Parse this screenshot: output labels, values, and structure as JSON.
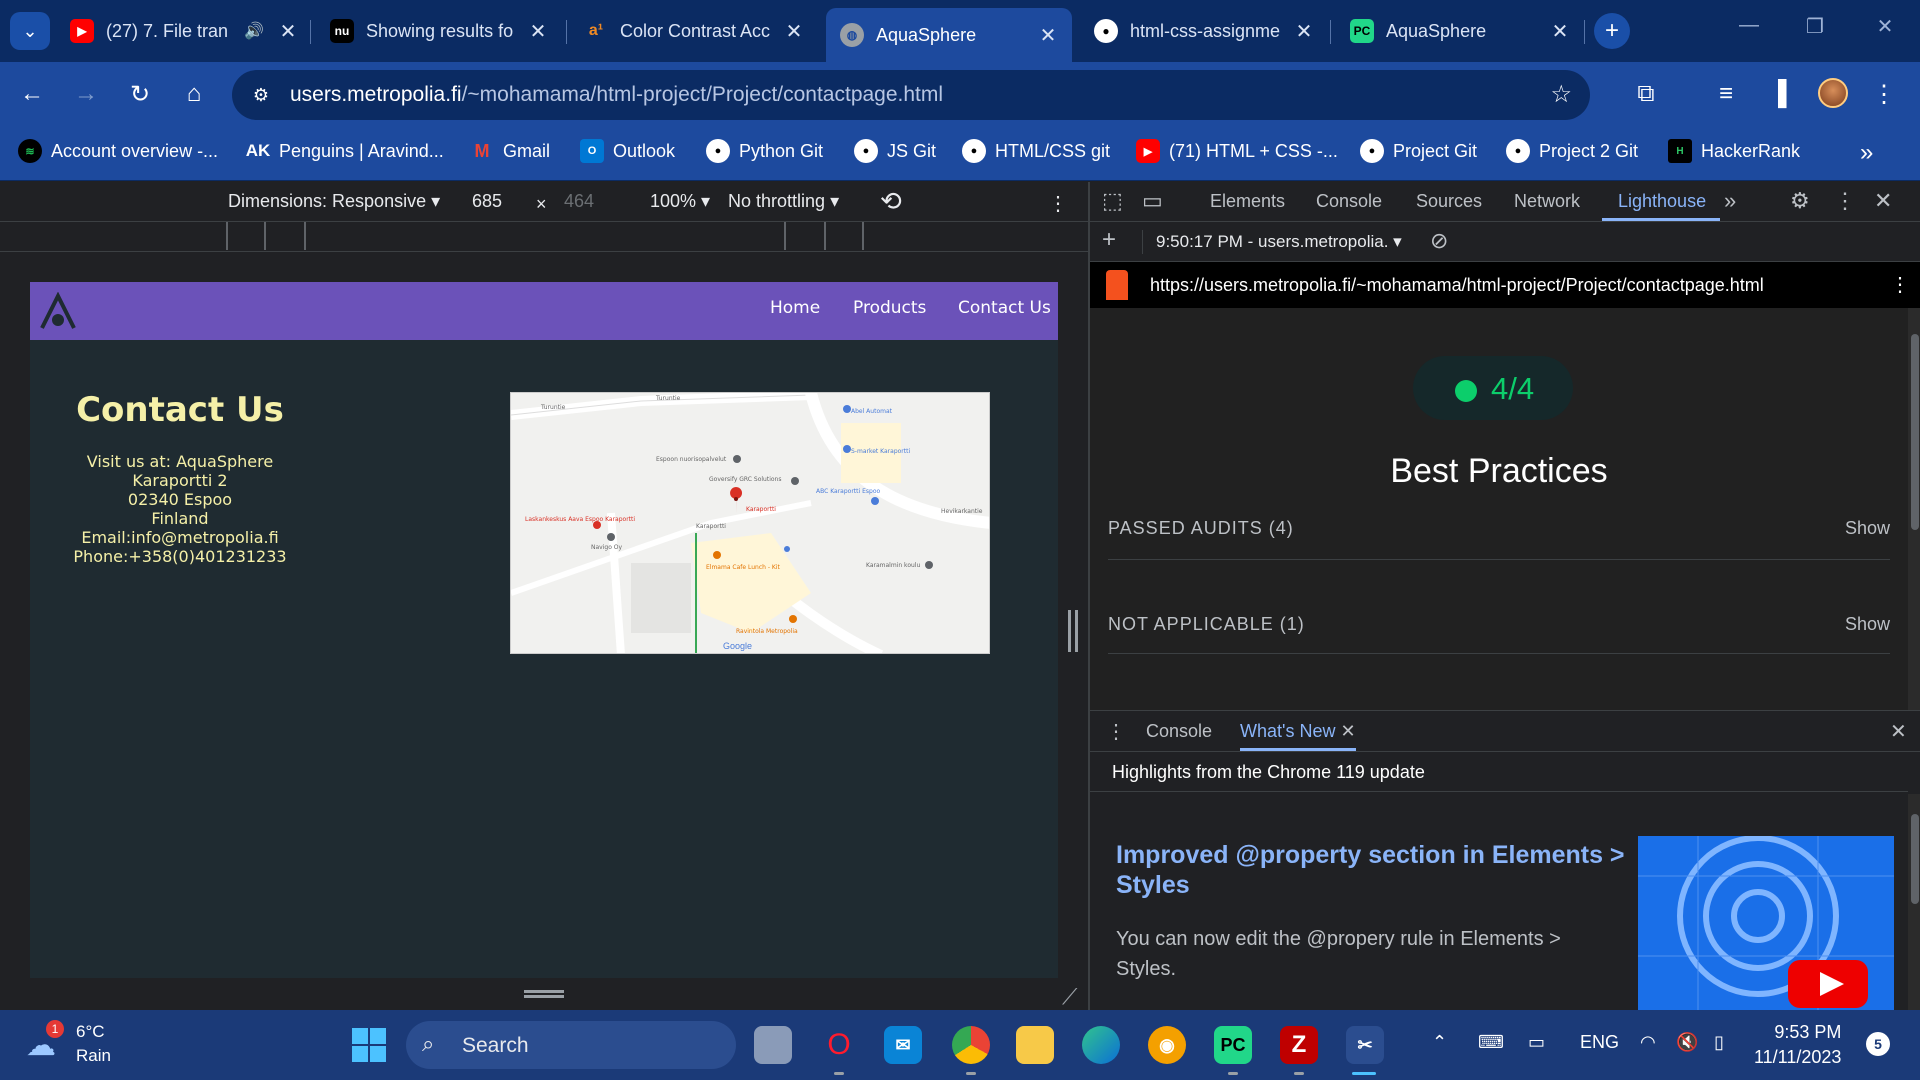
{
  "browser": {
    "tabs": [
      {
        "title": "(27) 7. File tran",
        "icon": "youtube-icon",
        "color": "#ff0000"
      },
      {
        "title": "Showing results fo",
        "icon": "nu-icon",
        "color": "#000000"
      },
      {
        "title": "Color Contrast Acc",
        "icon": "a11y-icon",
        "color": "#f08a24"
      },
      {
        "title": "AquaSphere",
        "icon": "globe-icon",
        "color": "#ffffff",
        "active": true
      },
      {
        "title": "html-css-assignme",
        "icon": "github-icon",
        "color": "#ffffff"
      },
      {
        "title": "AquaSphere",
        "icon": "pycharm-icon",
        "color": "#21d789"
      }
    ],
    "new_tab": "+",
    "window_controls": [
      "—",
      "❐",
      "✕"
    ],
    "url_host": "users.metropolia.fi",
    "url_path": "/~mohamama/html-project/Project/contactpage.html",
    "bookmarks": [
      {
        "label": "Account overview -...",
        "icon": "spotify-icon",
        "color": "#1db954"
      },
      {
        "label": "Penguins | Aravind...",
        "icon": "ak-icon",
        "color": "#ffffff"
      },
      {
        "label": "Gmail",
        "icon": "gmail-icon",
        "color": "#ea4335"
      },
      {
        "label": "Outlook",
        "icon": "outlook-icon",
        "color": "#0078d4"
      },
      {
        "label": "Python Git",
        "icon": "github-icon",
        "color": "#ffffff"
      },
      {
        "label": "JS Git",
        "icon": "github-icon",
        "color": "#ffffff"
      },
      {
        "label": "HTML/CSS git",
        "icon": "github-icon",
        "color": "#ffffff"
      },
      {
        "label": "(71) HTML + CSS -...",
        "icon": "youtube-icon",
        "color": "#ff0000"
      },
      {
        "label": "Project Git",
        "icon": "github-icon",
        "color": "#ffffff"
      },
      {
        "label": "Project 2 Git",
        "icon": "github-icon",
        "color": "#ffffff"
      },
      {
        "label": "HackerRank",
        "icon": "hackerrank-icon",
        "color": "#2ec866"
      }
    ]
  },
  "device_toolbar": {
    "dimensions": "Dimensions: Responsive",
    "width": "685",
    "times": "×",
    "height": "464",
    "zoom": "100%",
    "throttling": "No throttling"
  },
  "website": {
    "nav": [
      "Home",
      "Products",
      "Contact Us"
    ],
    "heading": "Contact Us",
    "lines": [
      "Visit us at: AquaSphere",
      "Karaportti 2",
      "02340 Espoo",
      "Finland",
      "Email:info@metropolia.fi",
      "Phone:+358(0)401231233"
    ],
    "map_labels": {
      "road1": "Turuntie",
      "road2": "Turuntie",
      "place1": "Abel Automat",
      "place2": "S-market Karaportti",
      "place3": "Espoon nuorisopalvelut",
      "place4": "Goversify GRC Solutions",
      "place5": "ABC Karaportti Espoo",
      "place6": "Karaportti",
      "place7": "Laskankeskus Aava Espoo Karaportti",
      "place8": "Navigo Oy",
      "place9": "Elmama Cafe Lunch - Kit",
      "place10": "Karamalmin koulu",
      "place11": "Ravintola Metropolia",
      "road3": "Karaportti",
      "road4": "Hevikarkantie",
      "brand": "Google"
    }
  },
  "devtools": {
    "tabs": [
      "Elements",
      "Console",
      "Sources",
      "Network",
      "Lighthouse"
    ],
    "active_tab": "Lighthouse",
    "report_time": "9:50:17 PM - users.metropolia.",
    "report_url": "https://users.metropolia.fi/~mohamama/html-project/Project/contactpage.html",
    "score": "4/4",
    "category": "Best Practices",
    "audit_groups": [
      {
        "label": "PASSED AUDITS (4)",
        "action": "Show"
      },
      {
        "label": "NOT APPLICABLE (1)",
        "action": "Show"
      }
    ],
    "drawer_tabs": [
      "Console",
      "What's New"
    ],
    "highlights": "Highlights from the Chrome 119 update",
    "whats_new_title": "Improved @property section in Elements > Styles",
    "whats_new_body": "You can now edit the @propery rule in Elements > Styles."
  },
  "taskbar": {
    "weather_temp": "6°C",
    "weather_desc": "Rain",
    "weather_badge": "1",
    "search_placeholder": "Search",
    "language": "ENG",
    "time": "9:53 PM",
    "date": "11/11/2023",
    "notifications": "5"
  }
}
